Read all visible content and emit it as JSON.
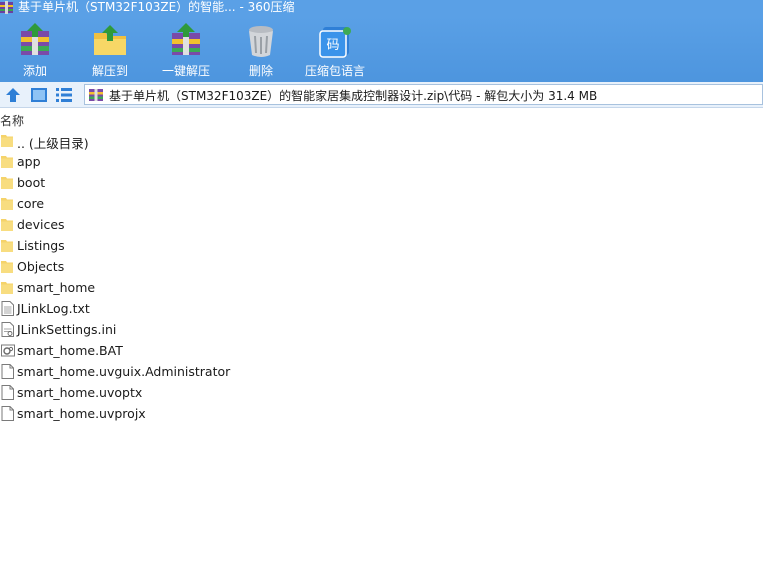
{
  "window": {
    "title": "基于单片机（STM32F103ZE）的智能... - 360压缩"
  },
  "toolbar": {
    "buttons": [
      {
        "label": "添加",
        "icon": "add-archive-icon"
      },
      {
        "label": "解压到",
        "icon": "extract-to-icon"
      },
      {
        "label": "一键解压",
        "icon": "one-click-extract-icon"
      },
      {
        "label": "删除",
        "icon": "delete-trash-icon"
      },
      {
        "label": "压缩包语言",
        "icon": "archive-language-icon"
      }
    ]
  },
  "address": {
    "path": "基于单片机（STM32F103ZE）的智能家居集成控制器设计.zip\\代码 - 解包大小为 31.4 MB"
  },
  "columns": {
    "name": "名称"
  },
  "files": [
    {
      "name": ".. (上级目录)",
      "type": "folder"
    },
    {
      "name": "app",
      "type": "folder"
    },
    {
      "name": "boot",
      "type": "folder"
    },
    {
      "name": "core",
      "type": "folder"
    },
    {
      "name": "devices",
      "type": "folder"
    },
    {
      "name": "Listings",
      "type": "folder"
    },
    {
      "name": "Objects",
      "type": "folder"
    },
    {
      "name": "smart_home",
      "type": "folder"
    },
    {
      "name": "JLinkLog.txt",
      "type": "text"
    },
    {
      "name": "JLinkSettings.ini",
      "type": "ini"
    },
    {
      "name": "smart_home.BAT",
      "type": "bat"
    },
    {
      "name": "smart_home.uvguix.Administrator",
      "type": "file"
    },
    {
      "name": "smart_home.uvoptx",
      "type": "file"
    },
    {
      "name": "smart_home.uvprojx",
      "type": "file"
    }
  ],
  "colors": {
    "toolbar_blue": "#5aa0e6",
    "folder_yellow": "#f5d36a",
    "address_bg": "#e8f1fb"
  }
}
